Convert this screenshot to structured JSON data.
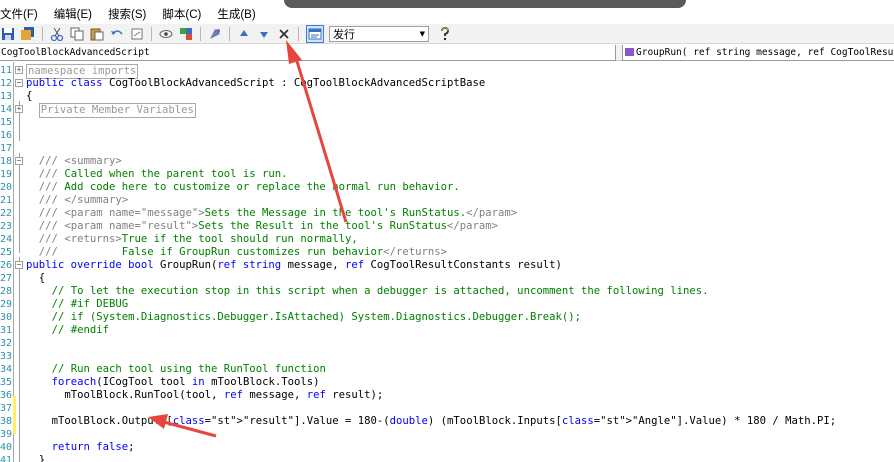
{
  "menu": [
    "文件(F)",
    "编辑(E)",
    "搜索(S)",
    "脚本(C)",
    "生成(B)"
  ],
  "toolbar": {
    "combo_value": "发行"
  },
  "selectors": {
    "class": "CogToolBlockAdvancedScript",
    "member": "GroupRun( ref string message,  ref CogToolResultCor"
  },
  "editor": {
    "lines": [
      {
        "n": "11",
        "code": "namespace imports"
      },
      {
        "n": "12",
        "code": "public class CogToolBlockAdvancedScript : CogToolBlockAdvancedScriptBase"
      },
      {
        "n": "13",
        "code": "{"
      },
      {
        "n": "14",
        "code": "Private Member Variables"
      },
      {
        "n": "15",
        "code": ""
      },
      {
        "n": "16",
        "code": ""
      },
      {
        "n": "17",
        "code": ""
      },
      {
        "n": "18",
        "code": "/// <summary>"
      },
      {
        "n": "19",
        "code": "/// Called when the parent tool is run."
      },
      {
        "n": "20",
        "code": "/// Add code here to customize or replace the normal run behavior."
      },
      {
        "n": "21",
        "code": "/// </summary>"
      },
      {
        "n": "22",
        "code": "/// <param name=\"message\">Sets the Message in the tool's RunStatus.</param>"
      },
      {
        "n": "23",
        "code": "/// <param name=\"result\">Sets the Result in the tool's RunStatus</param>"
      },
      {
        "n": "24",
        "code": "/// <returns>True if the tool should run normally,"
      },
      {
        "n": "25",
        "code": "///          False if GroupRun customizes run behavior</returns>"
      },
      {
        "n": "26",
        "code": "public override bool GroupRun(ref string message, ref CogToolResultConstants result)"
      },
      {
        "n": "27",
        "code": "{"
      },
      {
        "n": "28",
        "code": "// To let the execution stop in this script when a debugger is attached, uncomment the following lines."
      },
      {
        "n": "29",
        "code": "// #if DEBUG"
      },
      {
        "n": "30",
        "code": "// if (System.Diagnostics.Debugger.IsAttached) System.Diagnostics.Debugger.Break();"
      },
      {
        "n": "31",
        "code": "// #endif"
      },
      {
        "n": "32",
        "code": ""
      },
      {
        "n": "33",
        "code": ""
      },
      {
        "n": "34",
        "code": "// Run each tool using the RunTool function"
      },
      {
        "n": "35",
        "code": "foreach(ICogTool tool in mToolBlock.Tools)"
      },
      {
        "n": "36",
        "code": "mToolBlock.RunTool(tool, ref message, ref result);"
      },
      {
        "n": "37",
        "code": ""
      },
      {
        "n": "38",
        "code": "mToolBlock.Outputs[\"result\"].Value = 180-(double) (mToolBlock.Inputs[\"Angle\"].Value) * 180 / Math.PI;"
      },
      {
        "n": "39",
        "code": ""
      },
      {
        "n": "40",
        "code": "return false;"
      },
      {
        "n": "41",
        "code": "}"
      }
    ]
  },
  "colors": {
    "keyword": "#0000ff",
    "comment": "#008000",
    "doc_tag": "#808080",
    "string": "#a31515",
    "line_number": "#2b91af",
    "annotation_arrow": "#e8453c"
  },
  "icons": [
    "save-icon",
    "save-all-icon",
    "cut-icon",
    "copy-icon",
    "paste-icon",
    "undo-icon",
    "redo-icon",
    "toggle-breakpoint-icon",
    "run-icon",
    "debug-icon",
    "move-up-icon",
    "move-down-icon",
    "delete-icon",
    "build-icon",
    "help-icon"
  ]
}
